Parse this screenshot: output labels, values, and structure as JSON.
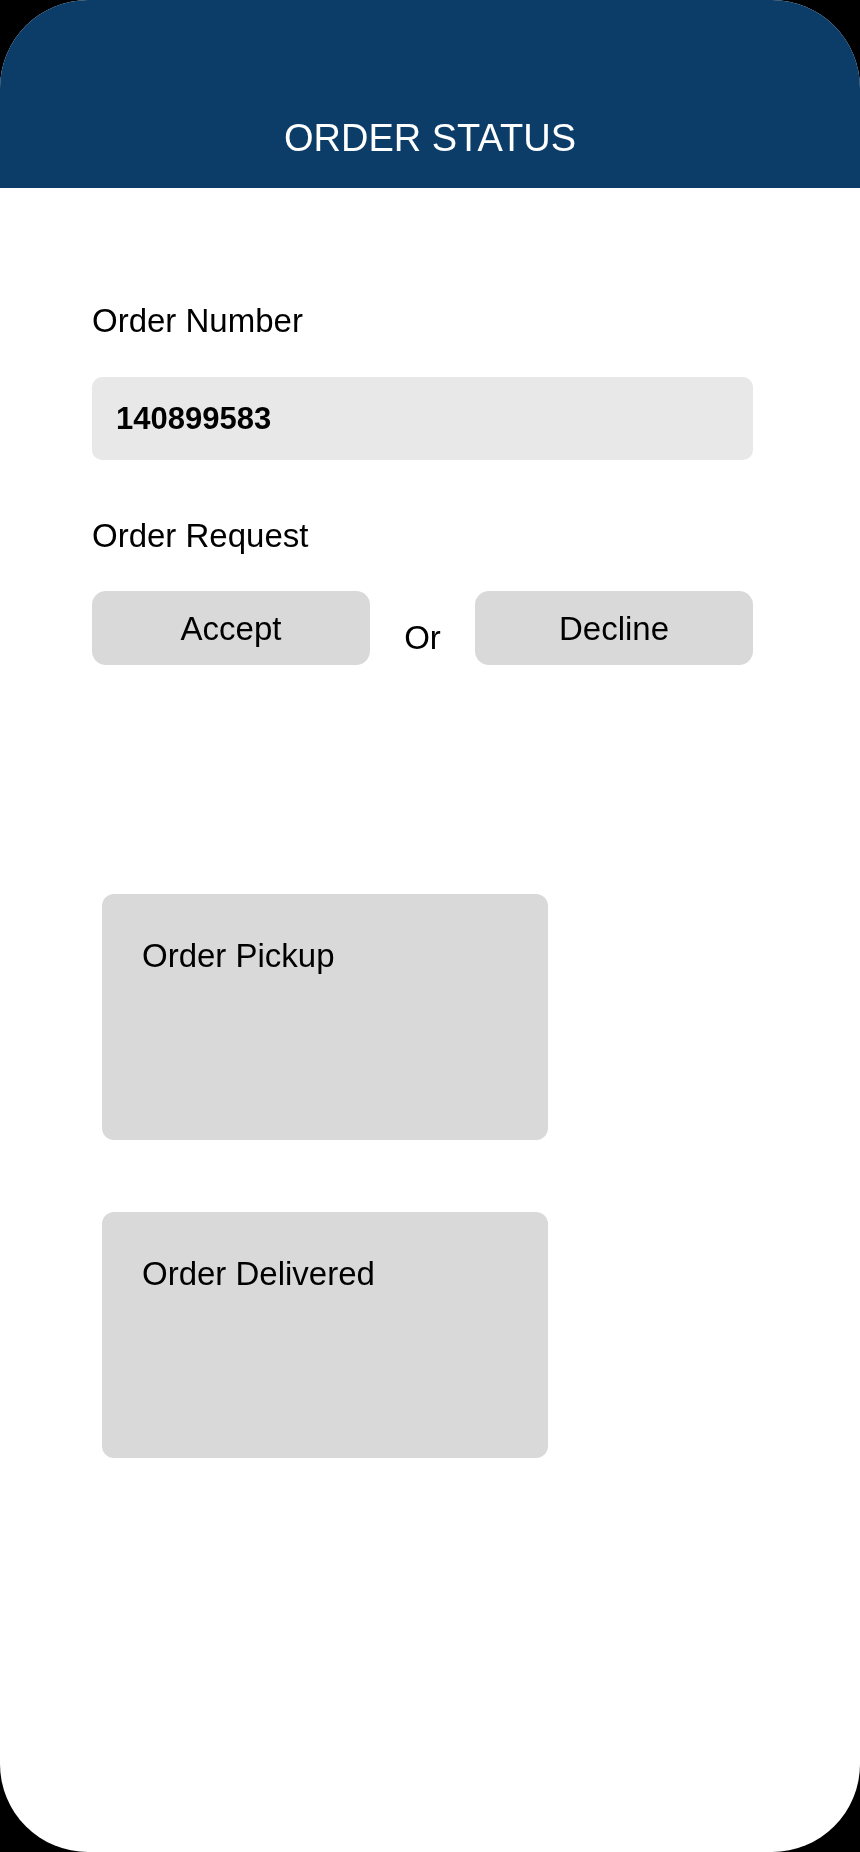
{
  "header": {
    "title": "ORDER STATUS"
  },
  "order_number": {
    "label": "Order Number",
    "value": "140899583"
  },
  "order_request": {
    "label": "Order Request",
    "items": [
      {
        "kind": "button",
        "label": "Accept"
      },
      {
        "kind": "separator",
        "label": "Or"
      },
      {
        "kind": "button",
        "label": "Decline"
      }
    ]
  },
  "status_cards": [
    {
      "title": "Order Pickup"
    },
    {
      "title": "Order Delivered"
    }
  ]
}
